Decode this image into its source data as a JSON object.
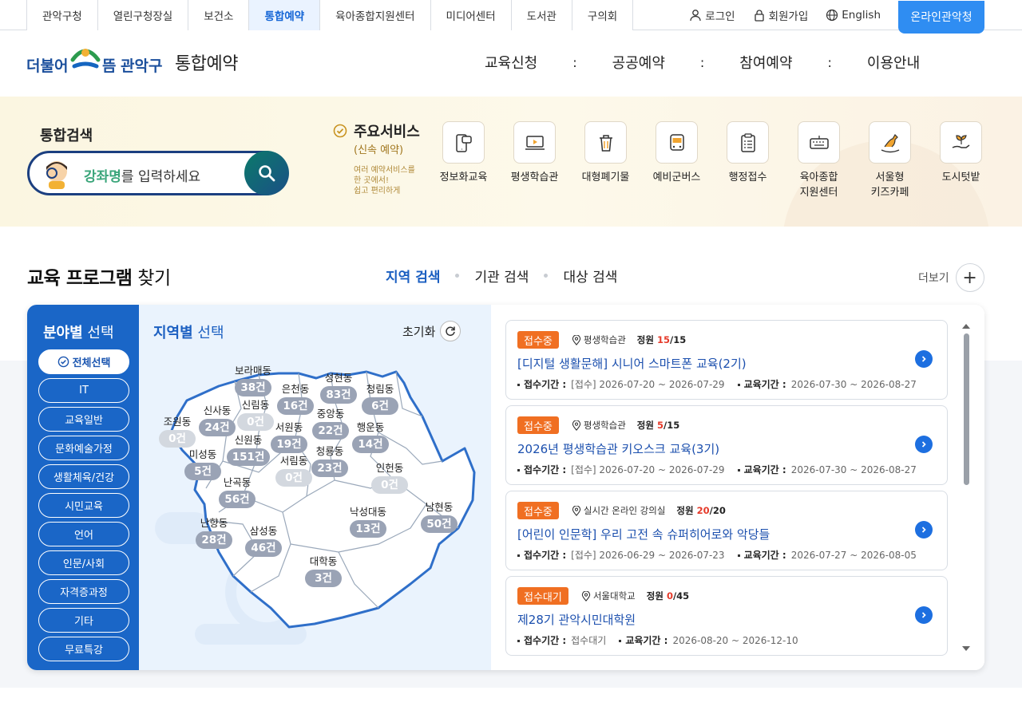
{
  "site_tabs": [
    "관악구청",
    "열린구청장실",
    "보건소",
    "통합예약",
    "육아종합지원센터",
    "미디어센터",
    "도서관",
    "구의회"
  ],
  "utils": {
    "login": "로그인",
    "signup": "회원가입",
    "english": "English",
    "online": "온라인관악청"
  },
  "header": {
    "slogan": "더불어",
    "slogan2": "뜸",
    "brand": "관악구",
    "title": "통합예약",
    "nav": [
      "교육신청",
      "공공예약",
      "참여예약",
      "이용안내"
    ],
    "nav_sep": ":"
  },
  "search": {
    "label": "통합검색",
    "keyword": "강좌명",
    "placeholder_rest": "를 입력하세요"
  },
  "services": {
    "title": "주요서비스",
    "subtitle": "(신속 예약)",
    "desc": [
      "여러 예약서비스를",
      "한 곳에서!",
      "쉽고 편리하게"
    ],
    "items": [
      {
        "name": "정보화교육",
        "icon": "phone-chat-icon"
      },
      {
        "name": "평생학습관",
        "icon": "laptop-play-icon"
      },
      {
        "name": "대형폐기물",
        "icon": "trash-can-icon"
      },
      {
        "name": "예비군버스",
        "icon": "bus-icon"
      },
      {
        "name": "행정접수",
        "icon": "clipboard-icon"
      },
      {
        "name": "육아종합\n지원센터",
        "icon": "keyboard-icon"
      },
      {
        "name": "서울형\n키즈카페",
        "icon": "rocking-horse-icon"
      },
      {
        "name": "도시텃밭",
        "icon": "sprout-hand-icon"
      }
    ]
  },
  "programs": {
    "title_bold": "교육 프로그램",
    "title_rest": " 찾기",
    "tabs": [
      "지역 검색",
      "기관 검색",
      "대상 검색"
    ],
    "more": "더보기",
    "field_title_bold": "분야별",
    "field_title_rest": " 선택",
    "fields": [
      "전체선택",
      "IT",
      "교육일반",
      "문화예술가정",
      "생활체육/건강",
      "시민교육",
      "언어",
      "인문/사회",
      "자격증과정",
      "기타",
      "무료특강"
    ],
    "region_title_bold": "지역별",
    "region_title_rest": " 선택",
    "reset": "초기화",
    "dongs": [
      {
        "name": "보라매동",
        "count": "38건"
      },
      {
        "name": "은천동",
        "count": "16건"
      },
      {
        "name": "성현동",
        "count": "83건"
      },
      {
        "name": "청림동",
        "count": "6건"
      },
      {
        "name": "신사동",
        "count": "24건"
      },
      {
        "name": "신림동",
        "count": "0건"
      },
      {
        "name": "중앙동",
        "count": "22건"
      },
      {
        "name": "조원동",
        "count": "0건"
      },
      {
        "name": "신원동",
        "count": "151건"
      },
      {
        "name": "서원동",
        "count": "19건"
      },
      {
        "name": "행운동",
        "count": "14건"
      },
      {
        "name": "미성동",
        "count": "5건"
      },
      {
        "name": "서림동",
        "count": "0건"
      },
      {
        "name": "청룡동",
        "count": "23건"
      },
      {
        "name": "인헌동",
        "count": "0건"
      },
      {
        "name": "난곡동",
        "count": "56건"
      },
      {
        "name": "남현동",
        "count": "50건"
      },
      {
        "name": "낙성대동",
        "count": "13건"
      },
      {
        "name": "난향동",
        "count": "28건"
      },
      {
        "name": "삼성동",
        "count": "46건"
      },
      {
        "name": "대학동",
        "count": "3건"
      }
    ],
    "list": [
      {
        "status": "접수중",
        "place": "평생학습관",
        "cap_label": "정원",
        "cap_now": "15",
        "cap_total": "/15",
        "title": "[디지털 생활문해] 시니어 스마트폰 교육(2기)",
        "apply_label": "접수기간 :",
        "apply": "[접수] 2026-07-20 ~ 2026-07-29",
        "edu_label": "교육기간 :",
        "edu": "2026-07-30 ~ 2026-08-27"
      },
      {
        "status": "접수중",
        "place": "평생학습관",
        "cap_label": "정원",
        "cap_now": "5",
        "cap_total": "/15",
        "title": "2026년 평생학습관 키오스크 교육(3기)",
        "apply_label": "접수기간 :",
        "apply": "[접수] 2026-07-20 ~ 2026-07-29",
        "edu_label": "교육기간 :",
        "edu": "2026-07-30 ~ 2026-08-27"
      },
      {
        "status": "접수중",
        "place": "실시간 온라인 강의실",
        "cap_label": "정원",
        "cap_now": "20",
        "cap_total": "/20",
        "title": "[어린이 인문학] 우리 고전 속 슈퍼히어로와 악당들",
        "apply_label": "접수기간 :",
        "apply": "[접수] 2026-06-29 ~ 2026-07-23",
        "edu_label": "교육기간 :",
        "edu": "2026-07-27 ~ 2026-08-05"
      },
      {
        "status": "접수대기",
        "place": "서울대학교",
        "cap_label": "정원",
        "cap_now": "0",
        "cap_total": "/45",
        "title": "제28기 관악시민대학원",
        "apply_label": "접수기간 :",
        "apply": "접수대기",
        "edu_label": "교육기간 :",
        "edu": "2026-08-20 ~ 2026-12-10"
      }
    ]
  },
  "colors": {
    "primary": "#1a66c7",
    "accent_orange": "#f06f22",
    "online_btn": "#2f8df2",
    "link_blue": "#1b4fae"
  }
}
